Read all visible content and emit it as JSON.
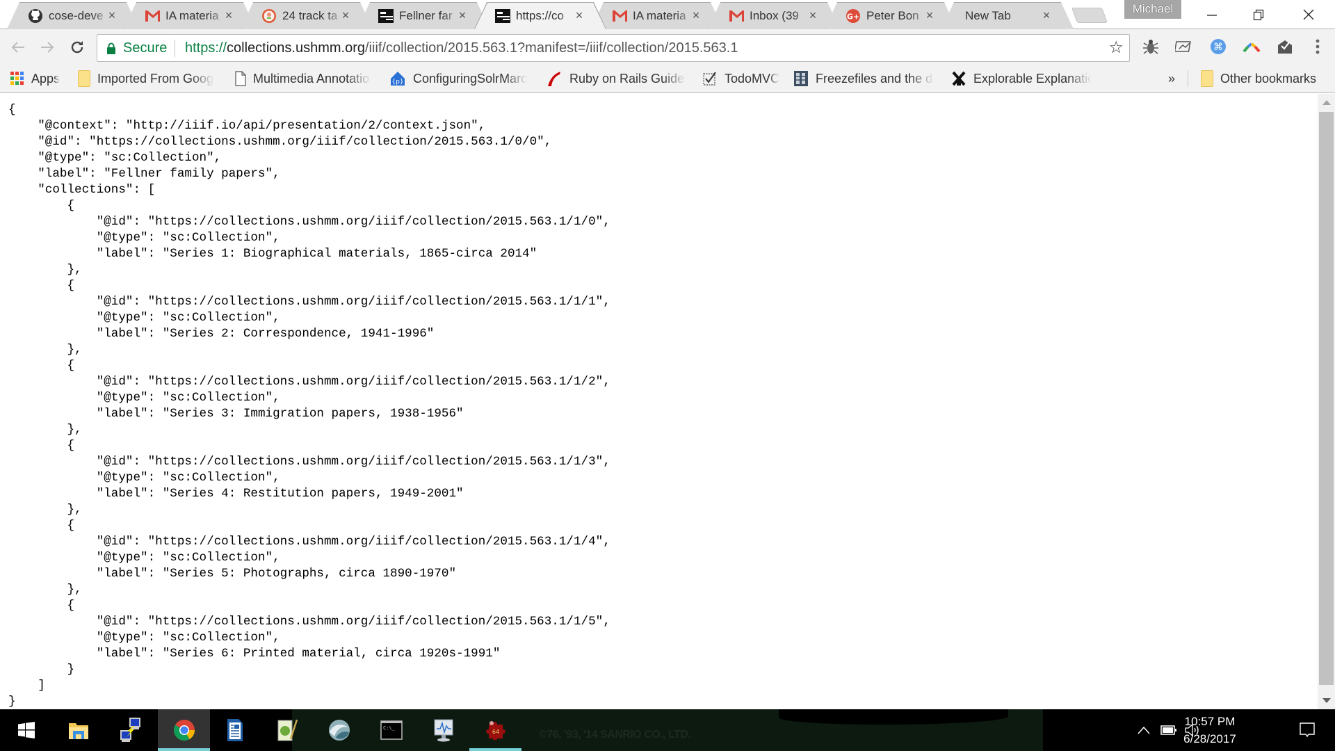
{
  "browser": {
    "tabs": [
      {
        "title": "cose-deve",
        "icon": "github-icon",
        "active": false
      },
      {
        "title": "IA materia",
        "icon": "gmail-icon",
        "active": false
      },
      {
        "title": "24 track ta",
        "icon": "duckduckgo-icon",
        "active": false
      },
      {
        "title": "Fellner far",
        "icon": "ushmm-icon",
        "active": false
      },
      {
        "title": "https://co",
        "icon": "ushmm-icon",
        "active": true
      },
      {
        "title": "IA materia",
        "icon": "gmail-icon",
        "active": false
      },
      {
        "title": "Inbox (39",
        "icon": "gmail-icon",
        "active": false
      },
      {
        "title": "Peter Bon",
        "icon": "google-plus-icon",
        "active": false
      },
      {
        "title": "New Tab",
        "icon": "",
        "active": false
      }
    ],
    "tab_close_glyph": "×",
    "profile_name": "Michael",
    "window_controls": {
      "minimize": "—",
      "restore": "❐",
      "close": "✕"
    },
    "toolbar": {
      "secure_label": "Secure",
      "url_scheme": "https://",
      "url_host": "collections.ushmm.org",
      "url_path": "/iiif/collection/2015.563.1?manifest=/iiif/collection/2015.563.1",
      "extensions": [
        "bug-extension-icon",
        "chart-extension-icon",
        "command-extension-icon",
        "rainbow-arc-extension-icon",
        "mail-check-extension-icon"
      ]
    },
    "bookmarks": [
      {
        "label": "Apps",
        "icon": "apps-grid-icon"
      },
      {
        "label": "Imported From Goog",
        "icon": "folder-icon"
      },
      {
        "label": "Multimedia Annotatio",
        "icon": "page-icon"
      },
      {
        "label": "ConfiguringSolrMarc",
        "icon": "house-icon"
      },
      {
        "label": "Ruby on Rails Guides",
        "icon": "rails-icon"
      },
      {
        "label": "TodoMVC",
        "icon": "checkbox-icon"
      },
      {
        "label": "Freezefiles and the da",
        "icon": "cabinet-icon"
      },
      {
        "label": "Explorable Explanatio",
        "icon": "windmill-icon"
      }
    ],
    "bookmarks_overflow": "»",
    "other_bookmarks": "Other bookmarks"
  },
  "document": {
    "context_key": "@context",
    "context": "http://iiif.io/api/presentation/2/context.json",
    "id_key": "@id",
    "id": "https://collections.ushmm.org/iiif/collection/2015.563.1/0/0",
    "type_key": "@type",
    "type": "sc:Collection",
    "label_key": "label",
    "label": "Fellner family papers",
    "collections_key": "collections",
    "collections": [
      {
        "id": "https://collections.ushmm.org/iiif/collection/2015.563.1/1/0",
        "type": "sc:Collection",
        "label": "Series 1: Biographical materials, 1865-circa 2014"
      },
      {
        "id": "https://collections.ushmm.org/iiif/collection/2015.563.1/1/1",
        "type": "sc:Collection",
        "label": "Series 2: Correspondence, 1941-1996"
      },
      {
        "id": "https://collections.ushmm.org/iiif/collection/2015.563.1/1/2",
        "type": "sc:Collection",
        "label": "Series 3: Immigration papers, 1938-1956"
      },
      {
        "id": "https://collections.ushmm.org/iiif/collection/2015.563.1/1/3",
        "type": "sc:Collection",
        "label": "Series 4: Restitution papers, 1949-2001"
      },
      {
        "id": "https://collections.ushmm.org/iiif/collection/2015.563.1/1/4",
        "type": "sc:Collection",
        "label": "Series 5: Photographs, circa 1890-1970"
      },
      {
        "id": "https://collections.ushmm.org/iiif/collection/2015.563.1/1/5",
        "type": "sc:Collection",
        "label": "Series 6: Printed material, circa 1920s-1991"
      }
    ]
  },
  "taskbar": {
    "apps": [
      {
        "name": "start-button",
        "active": false,
        "running": false
      },
      {
        "name": "file-explorer",
        "active": false,
        "running": false
      },
      {
        "name": "network-connections",
        "active": false,
        "running": false
      },
      {
        "name": "chrome",
        "active": true,
        "running": true
      },
      {
        "name": "libreoffice-writer",
        "active": false,
        "running": false
      },
      {
        "name": "notepad-plus-plus",
        "active": false,
        "running": false
      },
      {
        "name": "wave-app",
        "active": false,
        "running": false
      },
      {
        "name": "command-prompt",
        "active": false,
        "running": false
      },
      {
        "name": "performance-monitor",
        "active": false,
        "running": false
      },
      {
        "name": "jigsaw-64",
        "active": false,
        "running": true
      }
    ],
    "wallpaper_text": "©76, '93, '14 SANRIO CO., LTD.",
    "clock_time": "10:57 PM",
    "clock_date": "6/28/2017"
  }
}
